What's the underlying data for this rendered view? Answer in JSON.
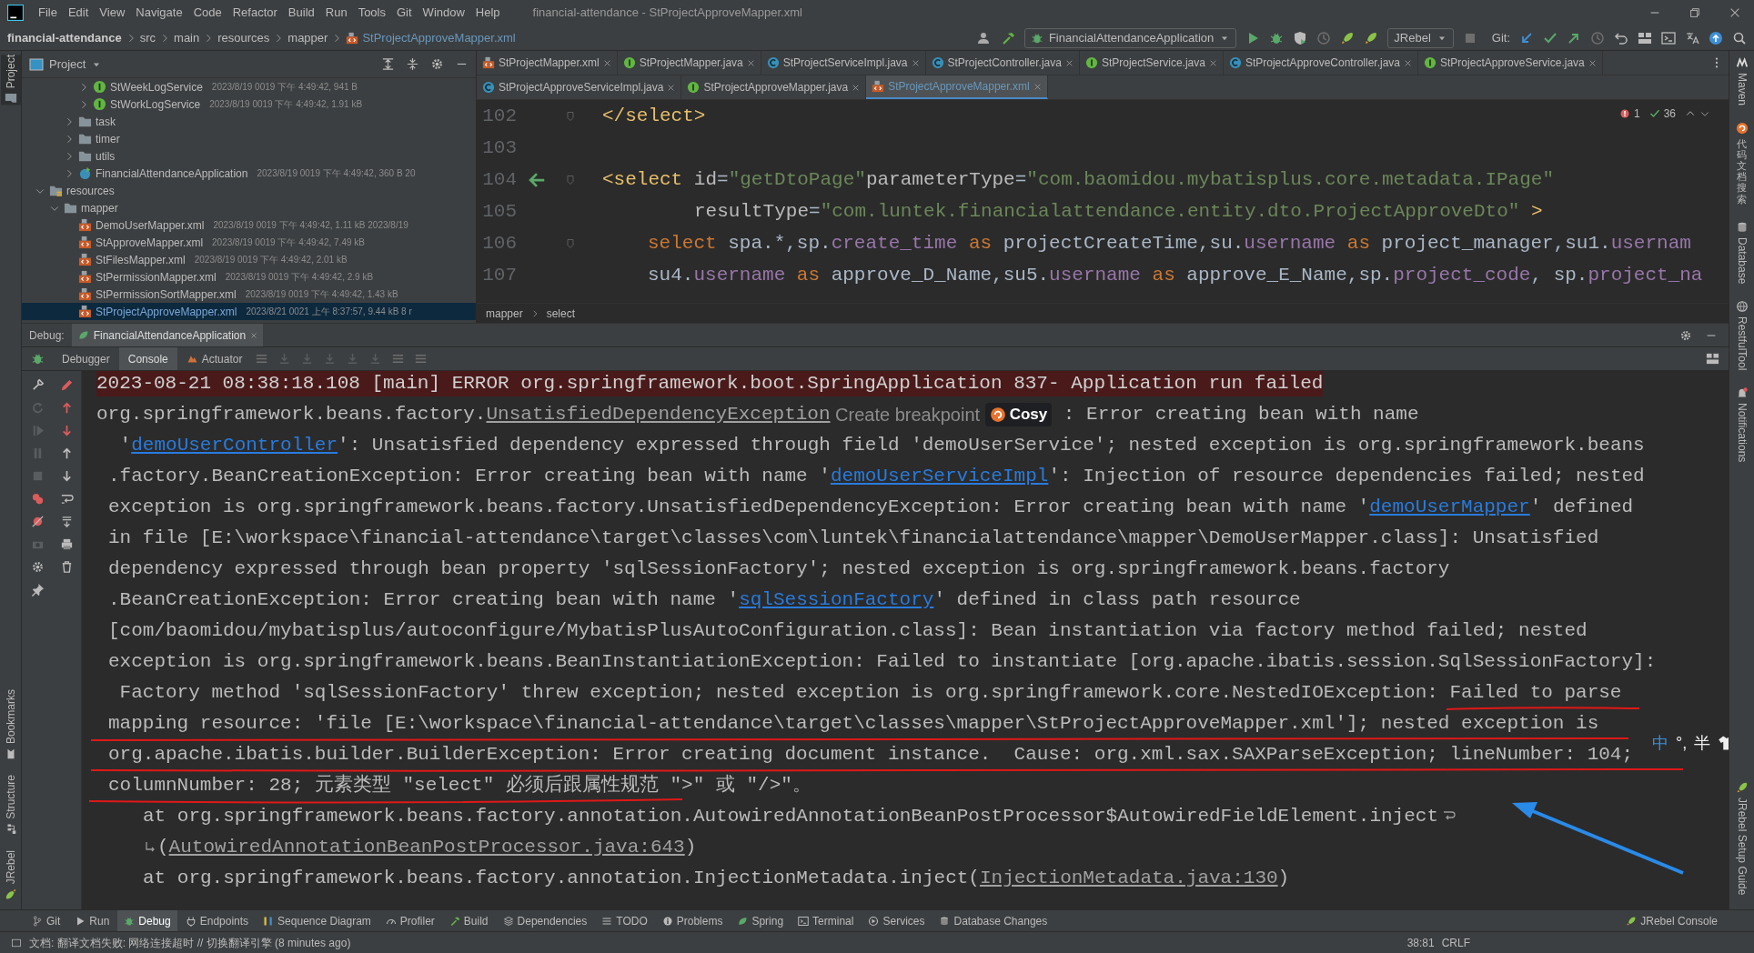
{
  "menu_bar": {
    "items": [
      "File",
      "Edit",
      "View",
      "Navigate",
      "Code",
      "Refactor",
      "Build",
      "Run",
      "Tools",
      "Git",
      "Window",
      "Help"
    ],
    "title": "financial-attendance - StProjectApproveMapper.xml"
  },
  "navigation_bar": {
    "breadcrumbs": [
      "financial-attendance",
      "src",
      "main",
      "resources",
      "mapper",
      "StProjectApproveMapper.xml"
    ],
    "run_configuration": "FinancialAttendanceApplication",
    "jrebel_menu": "JRebel",
    "git_label": "Git:"
  },
  "left_stripe": {
    "top": [
      {
        "label": "Project",
        "kind": "folder",
        "selected": true
      }
    ],
    "bottom": [
      {
        "label": "Bookmarks",
        "kind": "bookmark",
        "selected": false
      },
      {
        "label": "Structure",
        "kind": "structure",
        "selected": false
      },
      {
        "label": "JRebel",
        "kind": "rocket",
        "selected": false
      }
    ]
  },
  "project_panel": {
    "title": "Project",
    "tree": [
      {
        "children": [
          {
            "children": [
              {
                "children": [
                  {
                    "label": "StWeekLogService",
                    "meta": "2023/8/19 0019 下午 4:49:42, 941 B",
                    "kind": "interface",
                    "expanded": false,
                    "selected": false
                  },
                  {
                    "label": "StWorkLogService",
                    "meta": "2023/8/19 0019 下午 4:49:42, 1.91 kB",
                    "kind": "interface",
                    "expanded": false,
                    "selected": false
                  }
                ]
              },
              {
                "label": "task",
                "kind": "folder",
                "expanded": false,
                "selected": false
              },
              {
                "label": "timer",
                "kind": "folder",
                "expanded": false,
                "selected": false
              },
              {
                "label": "utils",
                "kind": "folder",
                "expanded": false,
                "selected": false
              },
              {
                "label": "FinancialAttendanceApplication",
                "meta": "2023/8/19 0019 下午 4:49:42, 360 B 20",
                "kind": "app",
                "expanded": false,
                "selected": false
              }
            ]
          }
        ]
      },
      {
        "label": "resources",
        "kind": "resources",
        "expanded": true,
        "selected": false,
        "children": [
          {
            "label": "mapper",
            "kind": "folder",
            "expanded": true,
            "selected": false,
            "children": [
              {
                "label": "DemoUserMapper.xml",
                "meta": "2023/8/19 0019 下午 4:49:42, 1.11 kB 2023/8/19",
                "kind": "xml",
                "selected": false
              },
              {
                "label": "StApproveMapper.xml",
                "meta": "2023/8/19 0019 下午 4:49:42, 7.49 kB",
                "kind": "xml",
                "selected": false
              },
              {
                "label": "StFilesMapper.xml",
                "meta": "2023/8/19 0019 下午 4:49:42, 2.01 kB",
                "kind": "xml",
                "selected": false
              },
              {
                "label": "StPermissionMapper.xml",
                "meta": "2023/8/19 0019 下午 4:49:42, 2.9 kB",
                "kind": "xml",
                "selected": false
              },
              {
                "label": "StPermissionSortMapper.xml",
                "meta": "2023/8/19 0019 下午 4:49:42, 1.43 kB",
                "kind": "xml",
                "selected": false
              },
              {
                "label": "StProjectApproveMapper.xml",
                "meta": "2023/8/21 0021 上午 8:37:57, 9.44 kB 8 r",
                "kind": "xml",
                "selected": true
              }
            ]
          }
        ]
      }
    ]
  },
  "editor": {
    "tab_rows": [
      {
        "tabs": [
          {
            "label": "StProjectMapper.xml",
            "kind": "xml",
            "selected": false
          },
          {
            "label": "StProjectMapper.java",
            "kind": "interface",
            "selected": false
          },
          {
            "label": "StProjectServiceImpl.java",
            "kind": "class",
            "selected": false
          },
          {
            "label": "StProjectController.java",
            "kind": "class",
            "selected": false
          },
          {
            "label": "StProjectService.java",
            "kind": "interface",
            "selected": false
          },
          {
            "label": "StProjectApproveController.java",
            "kind": "class",
            "selected": false
          },
          {
            "label": "StProjectApproveService.java",
            "kind": "interface",
            "selected": false
          }
        ]
      },
      {
        "tabs": [
          {
            "label": "StProjectApproveServiceImpl.java",
            "kind": "class",
            "selected": false
          },
          {
            "label": "StProjectApproveMapper.java",
            "kind": "interface",
            "selected": false
          },
          {
            "label": "StProjectApproveMapper.xml",
            "kind": "xml",
            "selected": true
          }
        ]
      }
    ],
    "inspection": {
      "errors": "1",
      "passed": "36"
    },
    "lines": [
      {
        "number": "102",
        "kind": "markup",
        "fold": true,
        "navigate": false,
        "segments": [
          {
            "text": "</select>",
            "kind": "tag"
          }
        ]
      },
      {
        "number": "103",
        "fold": false,
        "navigate": false
      },
      {
        "number": "104",
        "kind": "markup",
        "fold": true,
        "navigate": true,
        "segments": [
          {
            "text": "<select ",
            "kind": "tag"
          },
          {
            "text": "id",
            "kind": "attr"
          },
          {
            "text": "=",
            "kind": "plain"
          },
          {
            "text": "\"getDtoPage\"",
            "kind": "value"
          },
          {
            "text": "parameterType",
            "kind": "attr"
          },
          {
            "text": "=",
            "kind": "plain"
          },
          {
            "text": "\"com.baomidou.mybatisplus.core.metadata.IPage\"",
            "kind": "value"
          }
        ]
      },
      {
        "number": "105",
        "kind": "attribute",
        "fold": false,
        "navigate": false,
        "segments": [
          {
            "text": "resultType",
            "kind": "attr"
          },
          {
            "text": "=",
            "kind": "plain"
          },
          {
            "text": "\"com.luntek.financialattendance.entity.dto.ProjectApproveDto\"",
            "kind": "value"
          },
          {
            "text": " >",
            "kind": "tag"
          }
        ]
      },
      {
        "number": "106",
        "kind": "sql",
        "fold": true,
        "navigate": false,
        "segments": [
          {
            "text": "select",
            "kind": "keyword"
          },
          {
            "text": " spa.*,sp.",
            "kind": "plain"
          },
          {
            "text": "create_time",
            "kind": "field"
          },
          {
            "text": " as",
            "kind": "keyword"
          },
          {
            "text": " projectCreateTime,su.",
            "kind": "plain"
          },
          {
            "text": "username",
            "kind": "field"
          },
          {
            "text": " as",
            "kind": "keyword"
          },
          {
            "text": " project_manager,su1.",
            "kind": "plain"
          },
          {
            "text": "usernam",
            "kind": "field"
          }
        ]
      },
      {
        "number": "107",
        "kind": "sql",
        "fold": false,
        "navigate": false,
        "segments": [
          {
            "text": "su4.",
            "kind": "plain"
          },
          {
            "text": "username",
            "kind": "field"
          },
          {
            "text": " as",
            "kind": "keyword"
          },
          {
            "text": " approve_D_Name,su5.",
            "kind": "plain"
          },
          {
            "text": "username",
            "kind": "field"
          },
          {
            "text": " as",
            "kind": "keyword"
          },
          {
            "text": " approve_E_Name,sp.",
            "kind": "plain"
          },
          {
            "text": "project_code",
            "kind": "field"
          },
          {
            "text": ", sp.",
            "kind": "plain"
          },
          {
            "text": "project_na",
            "kind": "field"
          }
        ]
      }
    ],
    "breadcrumbs": [
      "mapper",
      "select"
    ]
  },
  "debug_panel": {
    "title": "Debug:",
    "session": "FinancialAttendanceApplication",
    "tabs": [
      {
        "label": "Debugger",
        "kind": "plain",
        "selected": false
      },
      {
        "label": "Console",
        "kind": "plain",
        "selected": true
      },
      {
        "label": "Actuator",
        "kind": "actuator",
        "selected": false
      }
    ],
    "console_lines": [
      {
        "kind": "error",
        "segments": [
          {
            "kind": "text",
            "text": "2023-08-21 08:38:18.108 [main] ERROR org.springframework.boot.SpringApplication 837- Application run failed"
          }
        ]
      },
      {
        "kind": "header",
        "segments": [
          {
            "kind": "text",
            "text": "org.springframework.beans.factory."
          },
          {
            "kind": "class_link",
            "text": "UnsatisfiedDependencyException"
          },
          {
            "kind": "hint",
            "text": " Create breakpoint "
          },
          {
            "kind": "badge",
            "text": "Cosy"
          },
          {
            "kind": "text",
            "text": " : Error creating bean with name"
          }
        ]
      },
      {
        "kind": "body",
        "segments": [
          {
            "kind": "text",
            "text": " '"
          },
          {
            "kind": "link",
            "text": "demoUserController"
          },
          {
            "kind": "text",
            "text": "': Unsatisfied dependency expressed through field 'demoUserService'; nested exception is org.springframework.beans"
          }
        ]
      },
      {
        "kind": "body",
        "segments": [
          {
            "kind": "text",
            "text": ".factory.BeanCreationException: Error creating bean with name '"
          },
          {
            "kind": "link",
            "text": "demoUserServiceImpl"
          },
          {
            "kind": "text",
            "text": "': Injection of resource dependencies failed; nested"
          }
        ]
      },
      {
        "kind": "body",
        "segments": [
          {
            "kind": "text",
            "text": "exception is org.springframework.beans.factory.UnsatisfiedDependencyException: Error creating bean with name '"
          },
          {
            "kind": "link",
            "text": "demoUserMapper"
          },
          {
            "kind": "text",
            "text": "' defined"
          }
        ]
      },
      {
        "kind": "body",
        "segments": [
          {
            "kind": "text",
            "text": "in file [E:\\workspace\\financial-attendance\\target\\classes\\com\\luntek\\financialattendance\\mapper\\DemoUserMapper.class]: Unsatisfied"
          }
        ]
      },
      {
        "kind": "body",
        "segments": [
          {
            "kind": "text",
            "text": "dependency expressed through bean property 'sqlSessionFactory'; nested exception is org.springframework.beans.factory"
          }
        ]
      },
      {
        "kind": "body",
        "segments": [
          {
            "kind": "text",
            "text": ".BeanCreationException: Error creating bean with name '"
          },
          {
            "kind": "link",
            "text": "sqlSessionFactory"
          },
          {
            "kind": "text",
            "text": "' defined in class path resource"
          }
        ]
      },
      {
        "kind": "body",
        "segments": [
          {
            "kind": "text",
            "text": "[com/baomidou/mybatisplus/autoconfigure/MybatisPlusAutoConfiguration.class]: Bean instantiation via factory method failed; nested"
          }
        ]
      },
      {
        "kind": "body",
        "segments": [
          {
            "kind": "text",
            "text": "exception is org.springframework.beans.BeanInstantiationException: Failed to instantiate [org.apache.ibatis.session.SqlSessionFactory]:"
          }
        ]
      },
      {
        "kind": "body",
        "segments": [
          {
            "kind": "text",
            "text": " Factory method 'sqlSessionFactory' threw exception; nested exception is org.springframework.core.NestedIOException: Failed to parse"
          }
        ]
      },
      {
        "kind": "body",
        "segments": [
          {
            "kind": "text",
            "text": "mapping resource: 'file [E:\\workspace\\financial-attendance\\target\\classes\\mapper\\StProjectApproveMapper.xml']; nested exception is"
          }
        ]
      },
      {
        "kind": "body",
        "segments": [
          {
            "kind": "text",
            "text": "org.apache.ibatis.builder.BuilderException: Error creating document instance.  Cause: org.xml.sax.SAXParseException; lineNumber: 104;"
          }
        ]
      },
      {
        "kind": "body",
        "segments": [
          {
            "kind": "text",
            "text": "columnNumber: 28; 元素类型 \"select\" 必须后跟属性规范 \">\" 或 \"/>\"。"
          }
        ]
      },
      {
        "kind": "stack",
        "segments": [
          {
            "kind": "text",
            "text": "at org.springframework.beans.factory.annotation.AutowiredAnnotationBeanPostProcessor$AutowiredFieldElement.inject"
          },
          {
            "kind": "wrap"
          }
        ]
      },
      {
        "kind": "stack",
        "segments": [
          {
            "kind": "wrap_continue"
          },
          {
            "kind": "text",
            "text": "("
          },
          {
            "kind": "class_link",
            "text": "AutowiredAnnotationBeanPostProcessor.java:643"
          },
          {
            "kind": "text",
            "text": ")"
          }
        ]
      },
      {
        "kind": "stack",
        "segments": [
          {
            "kind": "text",
            "text": "at org.springframework.beans.factory.annotation.InjectionMetadata.inject("
          },
          {
            "kind": "class_link",
            "text": "InjectionMetadata.java:130"
          },
          {
            "kind": "text",
            "text": ")"
          }
        ]
      }
    ]
  },
  "ime_toolbar": {
    "items": [
      "中",
      "°,",
      "半"
    ]
  },
  "tool_window_bar": {
    "items": [
      {
        "label": "Git",
        "kind": "branch",
        "selected": false
      },
      {
        "label": "Run",
        "kind": "play",
        "selected": false
      },
      {
        "label": "Debug",
        "kind": "bug",
        "selected": true
      },
      {
        "label": "Endpoints",
        "kind": "plug",
        "selected": false
      },
      {
        "label": "Sequence Diagram",
        "kind": "diagram",
        "selected": false
      },
      {
        "label": "Profiler",
        "kind": "gauge",
        "selected": false
      },
      {
        "label": "Build",
        "kind": "hammer",
        "selected": false
      },
      {
        "label": "Dependencies",
        "kind": "layers",
        "selected": false
      },
      {
        "label": "TODO",
        "kind": "list",
        "selected": false
      },
      {
        "label": "Problems",
        "kind": "info",
        "selected": false
      },
      {
        "label": "Spring",
        "kind": "leaf",
        "selected": false
      },
      {
        "label": "Terminal",
        "kind": "terminal",
        "selected": false
      },
      {
        "label": "Services",
        "kind": "services",
        "selected": false
      },
      {
        "label": "Database Changes",
        "kind": "dbchanges",
        "selected": false
      }
    ],
    "right": "JRebel Console"
  },
  "status_bar": {
    "message": "文档: 翻译文档失败: 网络连接超时 // 切换翻译引擎 (8 minutes ago)",
    "position": "38:81",
    "line_separator": "CRLF"
  },
  "right_stripe": {
    "top": [
      {
        "label": "Maven",
        "kind": "maven",
        "stacked": false
      },
      {
        "label": "代码文档搜索",
        "kind": "swirl",
        "stacked": true
      },
      {
        "label": "Database",
        "kind": "database",
        "stacked": false
      },
      {
        "label": "RestfulTool",
        "kind": "globe",
        "stacked": false
      },
      {
        "label": "Notifications",
        "kind": "bell",
        "stacked": false
      }
    ],
    "bottom": [
      {
        "label": "JRebel Setup Guide",
        "kind": "rocket",
        "stacked": false
      }
    ]
  }
}
